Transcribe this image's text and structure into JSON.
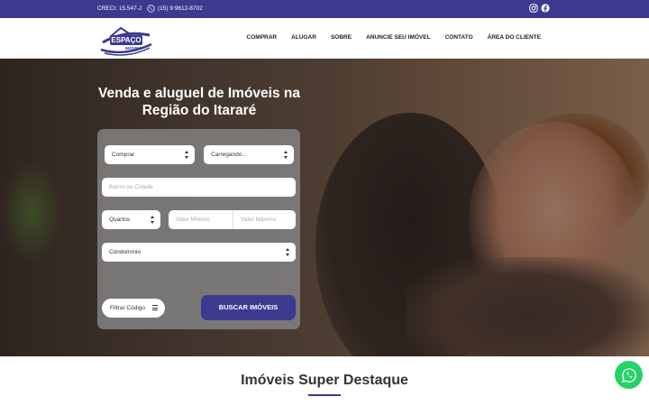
{
  "topbar": {
    "creci": "CRECI: 15.547-J",
    "phone": "(15) 9 9612-8702",
    "icons": [
      "whatsapp-icon",
      "instagram-icon",
      "facebook-icon"
    ]
  },
  "brand": {
    "logo_line1": "ESPAÇO",
    "logo_line2": "IMÓVEIS",
    "color": "#3b3a8f"
  },
  "nav": {
    "items": [
      "COMPRAR",
      "ALUGAR",
      "SOBRE",
      "ANUNCIE SEU IMÓVEL",
      "CONTATO",
      "ÁREA DO CLIENTE"
    ]
  },
  "hero": {
    "title": "Venda e aluguel de Imóveis na Região do Itararé"
  },
  "search": {
    "type_select": "Comprar",
    "category_select": "Carregando...",
    "location_placeholder": "Bairro ou Cidade",
    "rooms_select": "Quartos",
    "min_placeholder": "Valor Mínimo",
    "max_placeholder": "Valor Máximo",
    "condo_select": "Condomínio",
    "filter_label": "Filtrar Código",
    "submit_label": "BUSCAR IMÓVEIS"
  },
  "section": {
    "title": "Imóveis Super Destaque"
  }
}
